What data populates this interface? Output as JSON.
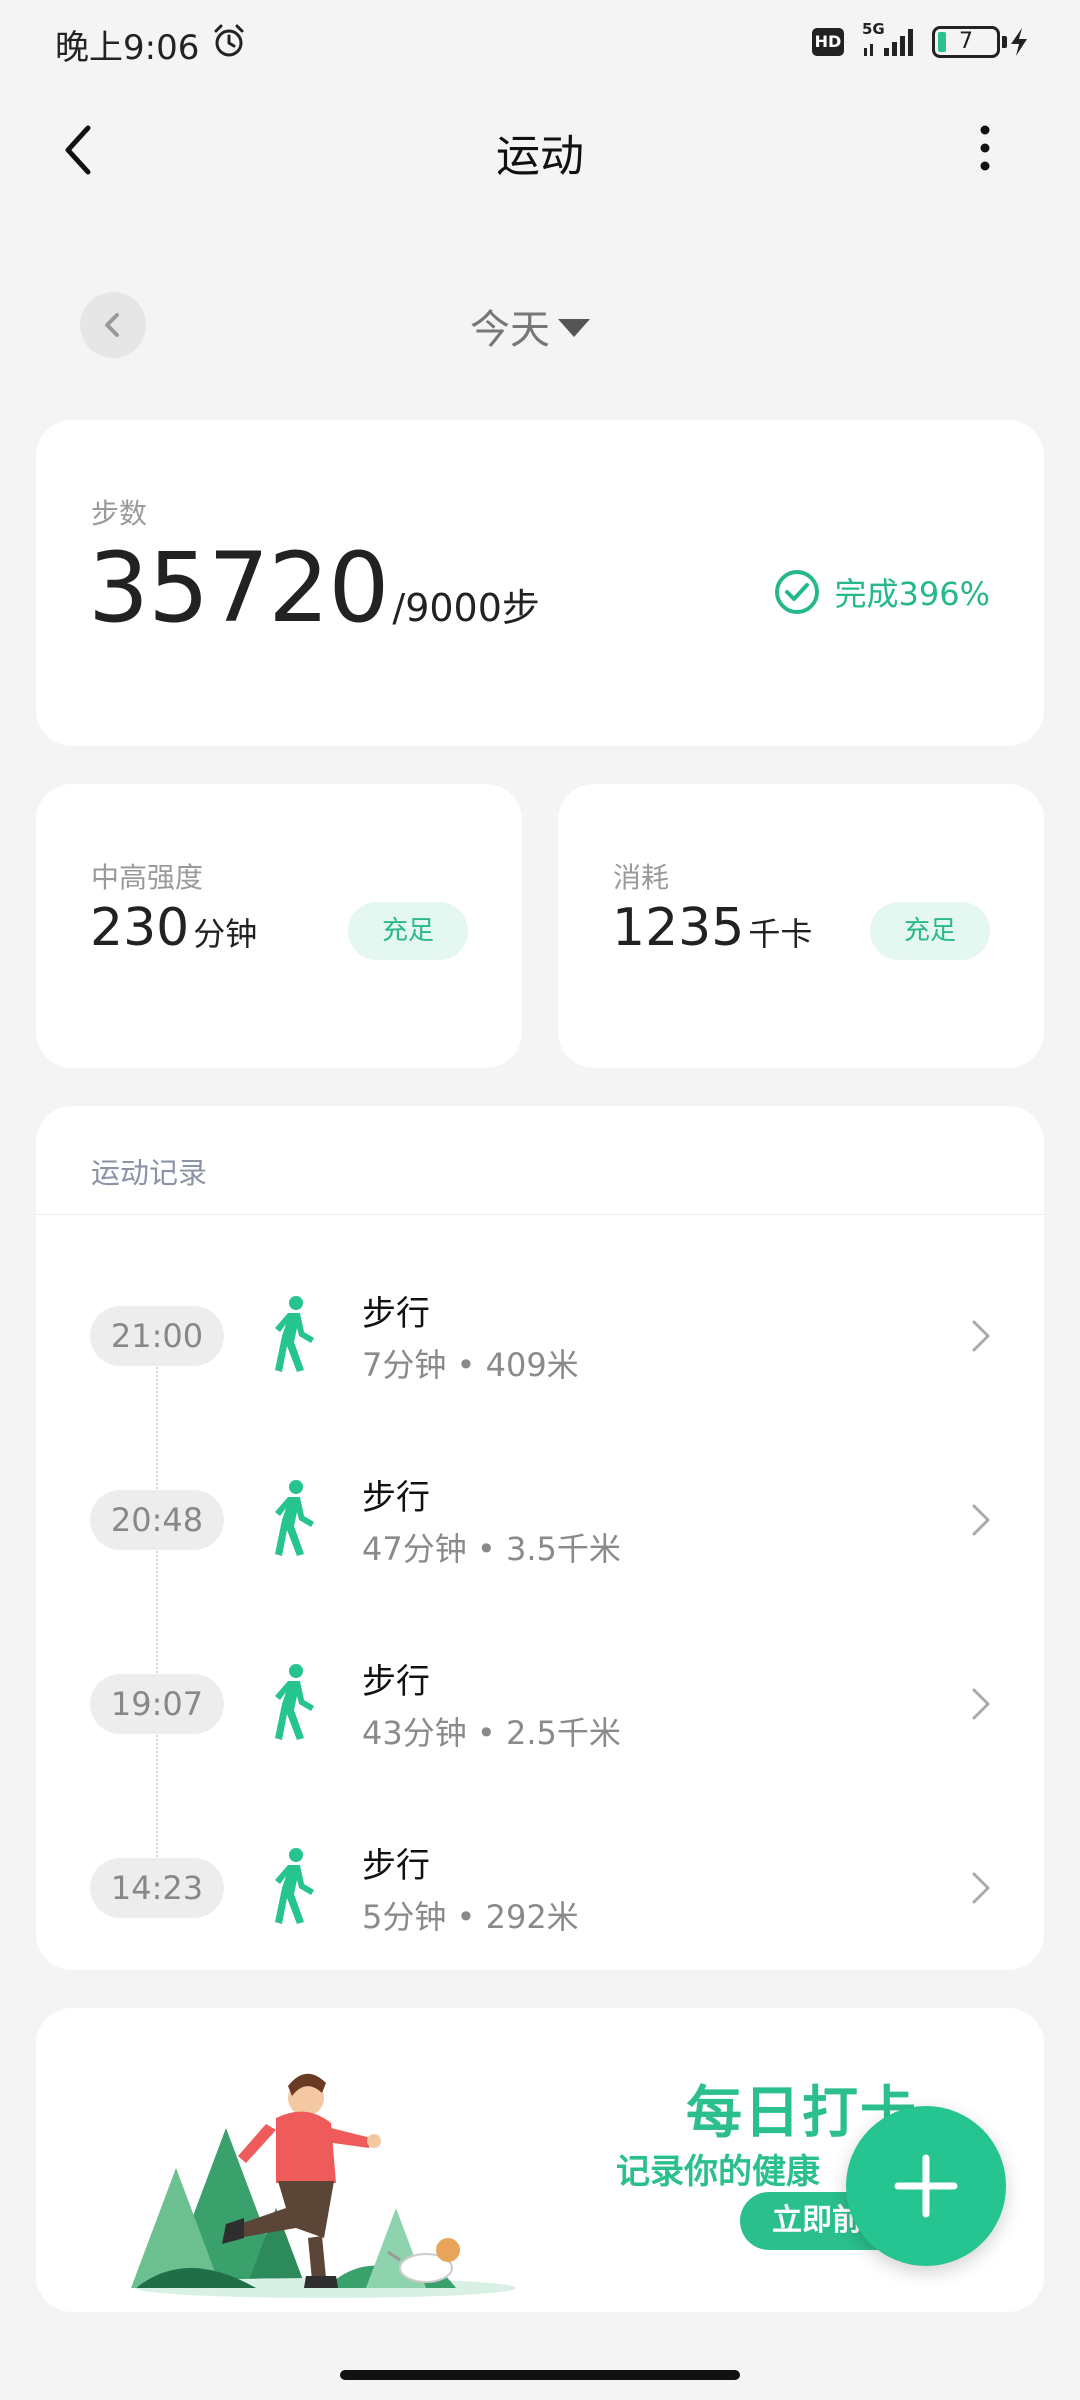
{
  "status_bar": {
    "time": "晚上9:06",
    "network": "5G",
    "hd": "HD",
    "battery": "7",
    "battery_color": "#2bc28c"
  },
  "header": {
    "title": "运动",
    "back_icon": "chevron-left-icon",
    "more_icon": "more-vertical-icon"
  },
  "date": {
    "label": "今天",
    "prev_icon": "chevron-left-icon"
  },
  "steps": {
    "label": "步数",
    "value": "35720",
    "goal": "/9000步",
    "complete_text": "完成396%",
    "accent": "#25b88c"
  },
  "intensity": {
    "label": "中高强度",
    "value": "230",
    "unit": "分钟",
    "tag": "充足"
  },
  "calories": {
    "label": "消耗",
    "value": "1235",
    "unit": "千卡",
    "tag": "充足"
  },
  "records": {
    "title": "运动记录",
    "items": [
      {
        "time": "21:00",
        "type": "步行",
        "duration": "7分钟",
        "distance": "409米",
        "icon": "walk-icon"
      },
      {
        "time": "20:48",
        "type": "步行",
        "duration": "47分钟",
        "distance": "3.5千米",
        "icon": "walk-icon"
      },
      {
        "time": "19:07",
        "type": "步行",
        "duration": "43分钟",
        "distance": "2.5千米",
        "icon": "walk-icon"
      },
      {
        "time": "14:23",
        "type": "步行",
        "duration": "5分钟",
        "distance": "292米",
        "icon": "walk-icon"
      }
    ]
  },
  "banner": {
    "title": "每日打卡",
    "subtitle": "记录你的健康",
    "button": "立即前"
  },
  "fab": {
    "icon": "plus-icon",
    "color": "#26c490"
  }
}
